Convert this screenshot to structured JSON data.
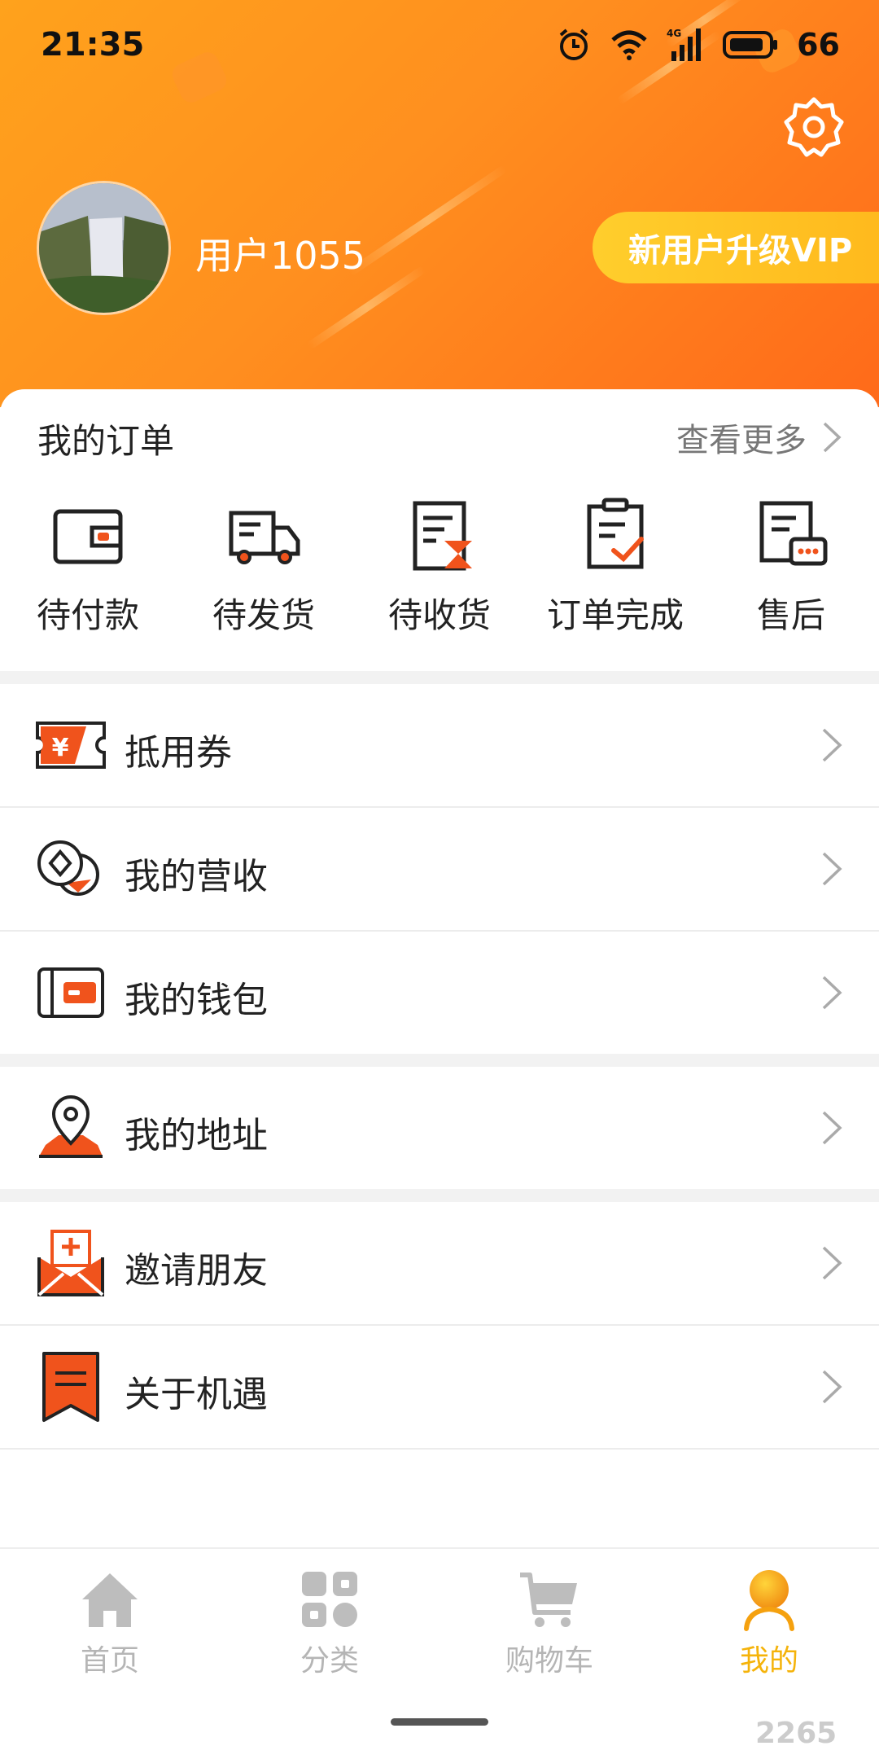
{
  "status_bar": {
    "time": "21:35",
    "network": "4G",
    "battery": "66"
  },
  "header": {
    "username": "用户1055",
    "vip_button": "新用户升级VIP"
  },
  "orders": {
    "title": "我的订单",
    "more": "查看更多",
    "items": [
      {
        "label": "待付款",
        "icon": "wallet-icon"
      },
      {
        "label": "待发货",
        "icon": "delivery-truck-icon"
      },
      {
        "label": "待收货",
        "icon": "hourglass-document-icon"
      },
      {
        "label": "订单完成",
        "icon": "checked-clipboard-icon"
      },
      {
        "label": "售后",
        "icon": "chat-document-icon"
      }
    ]
  },
  "menu": [
    {
      "label": "抵用券",
      "icon": "coupon-icon"
    },
    {
      "label": "我的营收",
      "icon": "coins-icon"
    },
    {
      "label": "我的钱包",
      "icon": "wallet-icon"
    },
    {
      "label": "我的地址",
      "icon": "location-pin-icon"
    },
    {
      "label": "邀请朋友",
      "icon": "invite-envelope-icon"
    },
    {
      "label": "关于机遇",
      "icon": "bookmark-icon"
    }
  ],
  "tabs": [
    {
      "label": "首页",
      "icon": "home-icon",
      "active": false
    },
    {
      "label": "分类",
      "icon": "category-grid-icon",
      "active": false
    },
    {
      "label": "购物车",
      "icon": "shopping-cart-icon",
      "active": false
    },
    {
      "label": "我的",
      "icon": "user-profile-icon",
      "active": true
    }
  ],
  "colors": {
    "brand_orange": "#ff7a1a",
    "accent_red": "#f0531c",
    "active_tab": "#f5b30a",
    "vip_yellow": "#ffc629"
  },
  "watermark": "2265"
}
